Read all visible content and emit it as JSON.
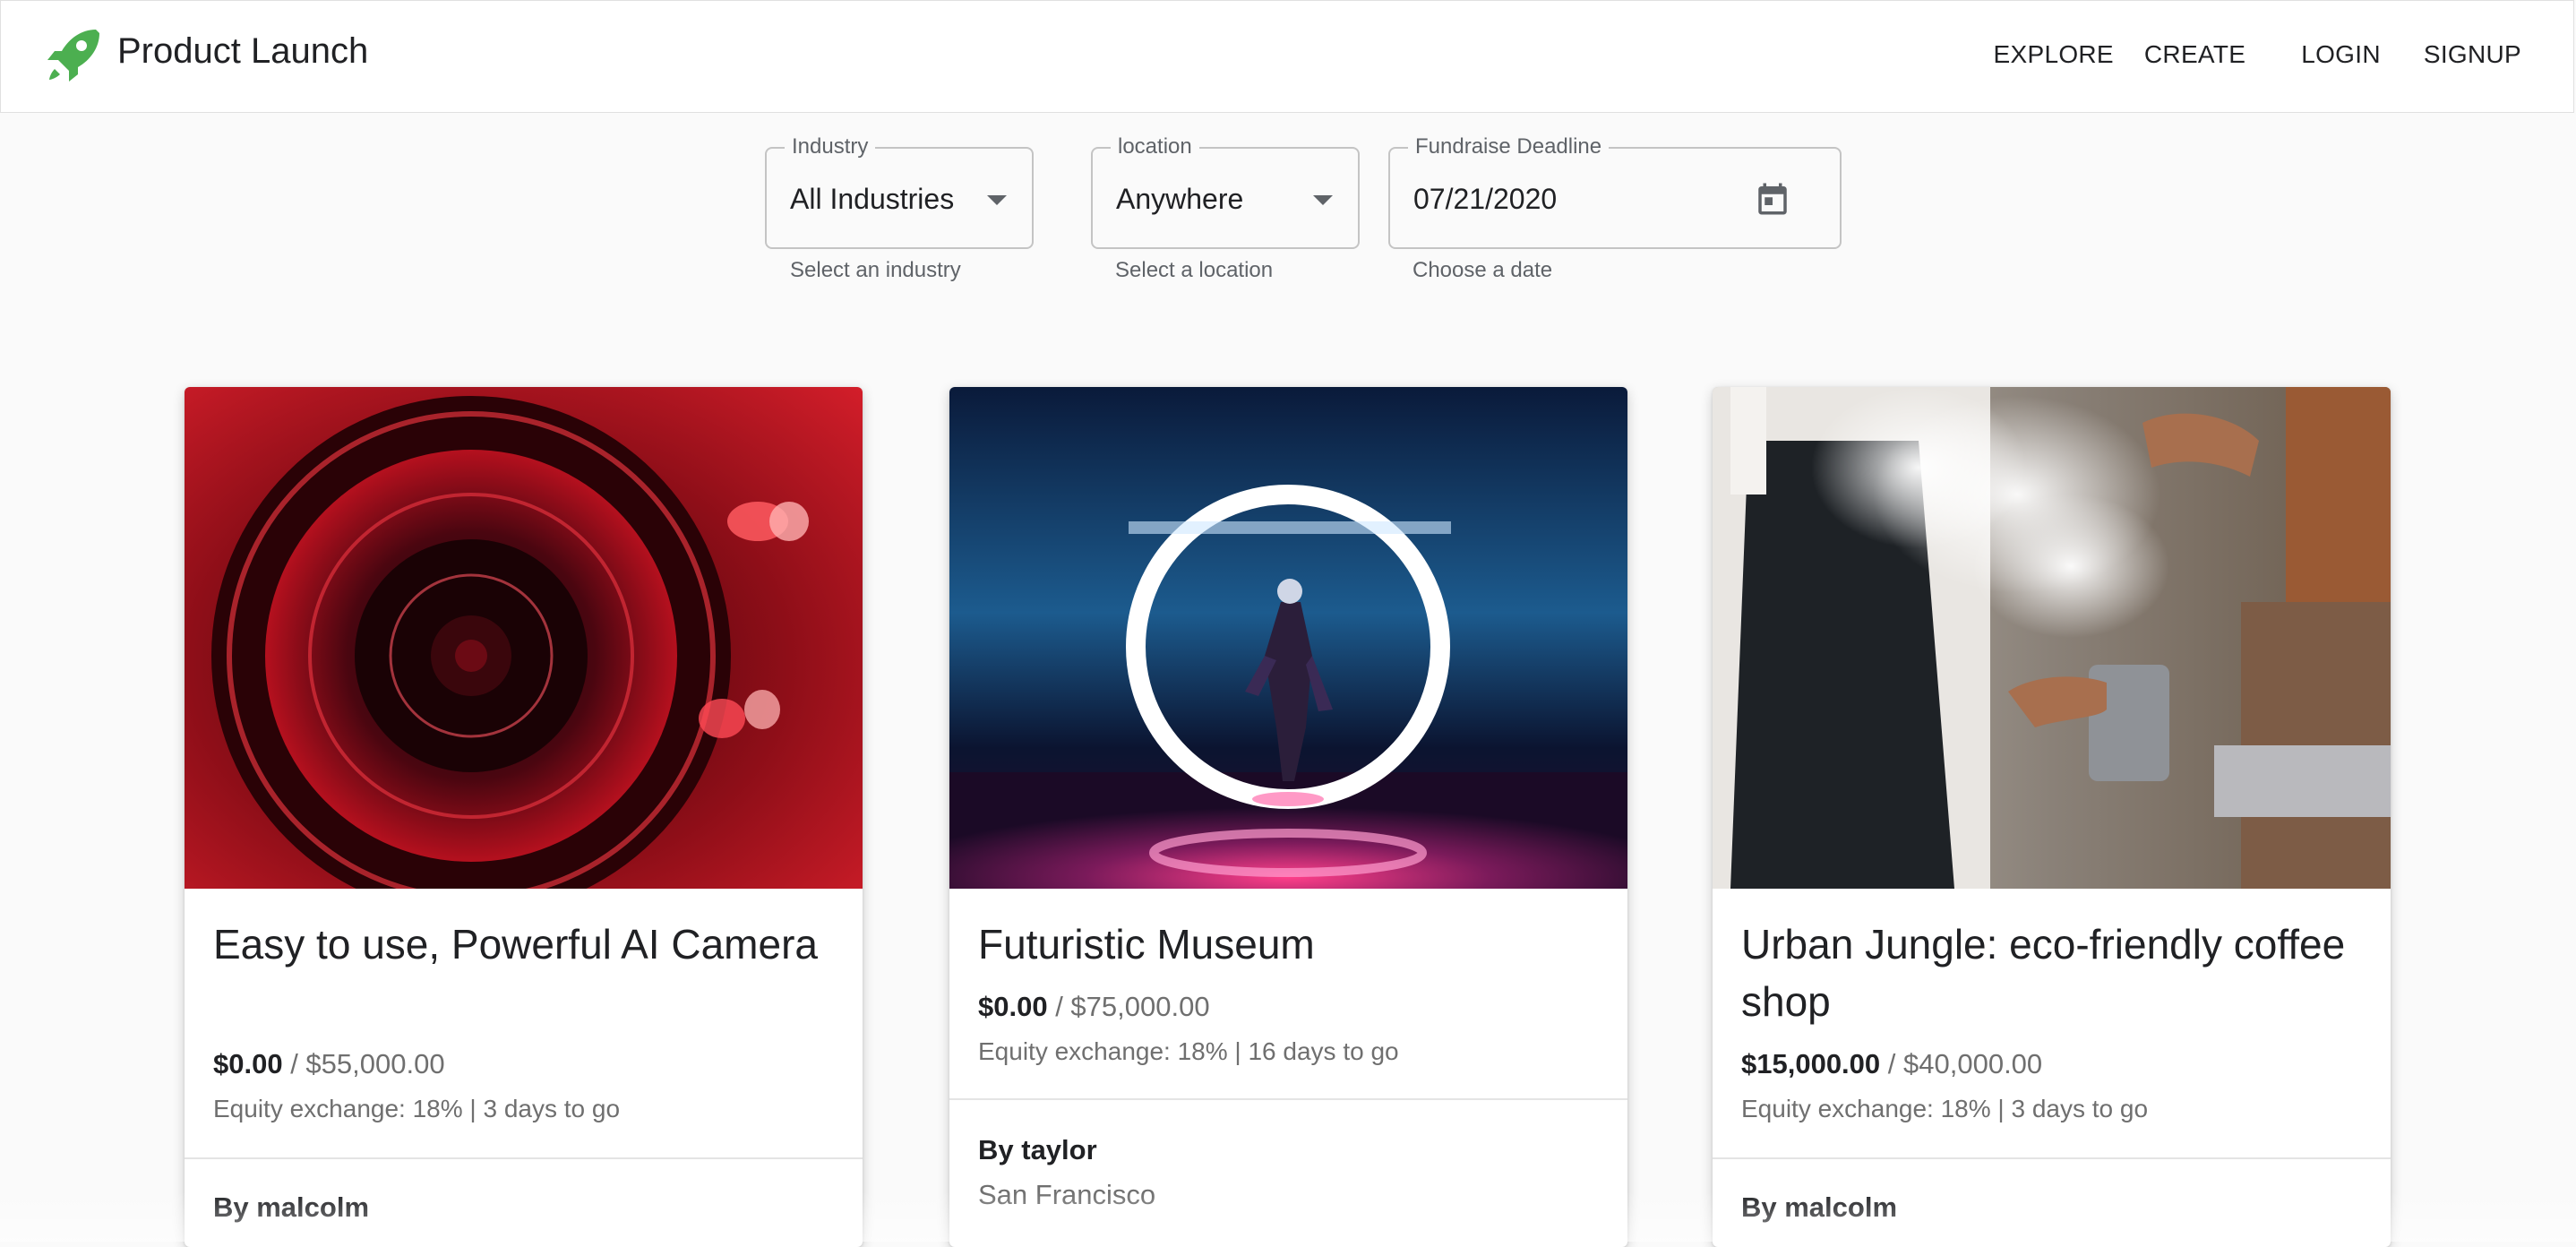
{
  "app": {
    "title": "Product Launch",
    "logo_icon": "rocket-icon",
    "accent_color": "#4caf50"
  },
  "nav": {
    "explore": "EXPLORE",
    "create": "CREATE",
    "login": "LOGIN",
    "signup": "SIGNUP"
  },
  "filters": {
    "industry": {
      "label": "Industry",
      "value": "All Industries",
      "helper": "Select an industry"
    },
    "location": {
      "label": "location",
      "value": "Anywhere",
      "helper": "Select a location"
    },
    "deadline": {
      "label": "Fundraise Deadline",
      "value": "07/21/2020",
      "helper": "Choose a date",
      "icon": "calendar-icon"
    }
  },
  "cards": [
    {
      "title": "Easy to use, Powerful AI Camera",
      "raised": "$0.00",
      "goal": "/ $55,000.00",
      "meta": "Equity exchange: 18% | 3 days to go",
      "author": "By malcolm",
      "image": "camera-lens-image"
    },
    {
      "title": "Futuristic Museum",
      "raised": "$0.00",
      "goal": "/ $75,000.00",
      "meta": "Equity exchange: 18% | 16 days to go",
      "author": "By taylor",
      "location": "San Francisco",
      "image": "museum-portal-image"
    },
    {
      "title": "Urban Jungle: eco-friendly coffee shop",
      "raised": "$15,000.00",
      "goal": "/ $40,000.00",
      "meta": "Equity exchange: 18% | 3 days to go",
      "author": "By malcolm",
      "image": "barista-steam-image"
    }
  ]
}
